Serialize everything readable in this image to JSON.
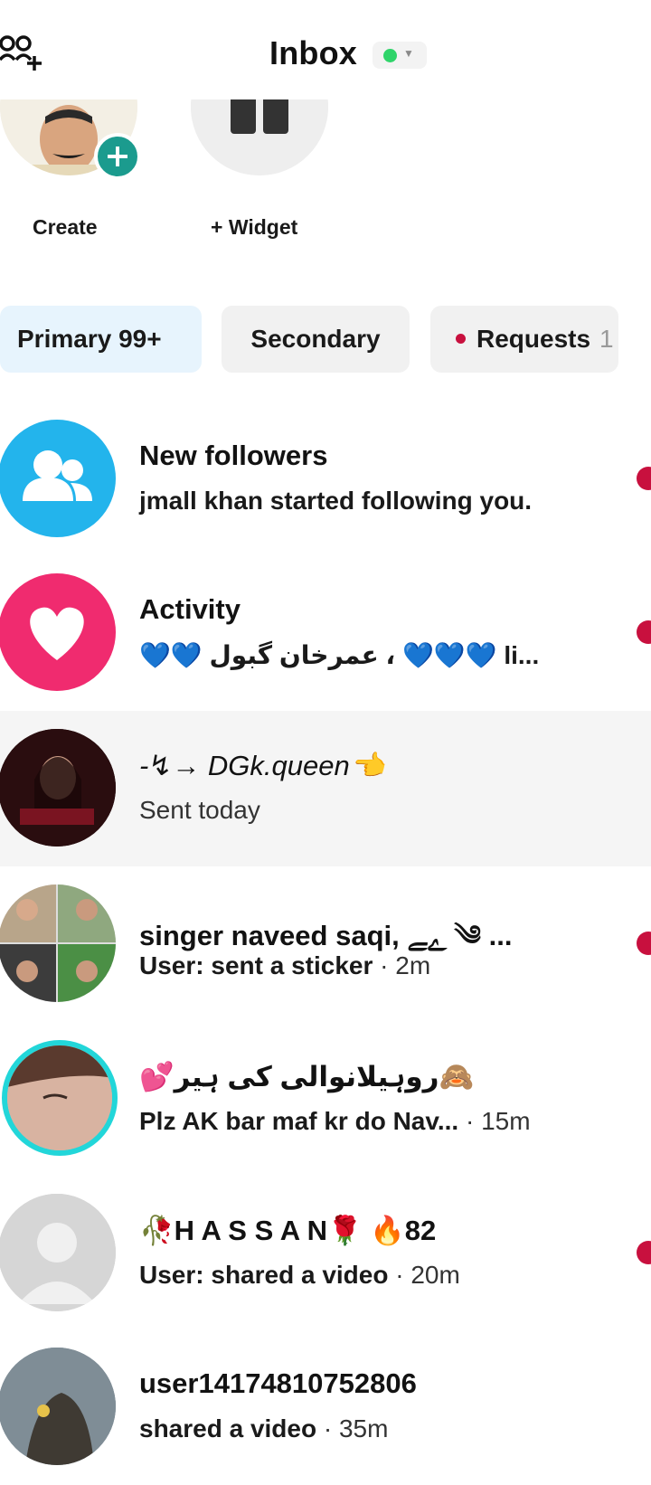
{
  "header": {
    "title": "Inbox",
    "status_color": "#2fd46a",
    "add_friends_icon": "add-friends-icon"
  },
  "stories": {
    "create_label": "Create",
    "widget_label": "+ Widget"
  },
  "tabs": {
    "primary": "Primary 99+",
    "secondary": "Secondary",
    "requests": "Requests",
    "requests_count": "1"
  },
  "threads": [
    {
      "title": "New followers",
      "subtitle": "jmall khan started following you.",
      "time": "",
      "icon": "people-icon",
      "unread": true
    },
    {
      "title": "Activity",
      "subtitle": "💙💙 عمرخان گبول ، 💙💙💙 li...",
      "time": "",
      "icon": "heart-icon",
      "unread": true
    },
    {
      "title": "-↯→ DGk.queen👈",
      "subtitle": "Sent today",
      "time": "",
      "unread": false
    },
    {
      "title": "singer naveed saqi, ﮮﮯ ༄ ...",
      "subtitle": "User: sent a sticker",
      "time": " · 2m",
      "unread": true
    },
    {
      "title": "💕روہیلانوالی کی ہیر🙈",
      "subtitle": "Plz AK bar maf kr do Nav...",
      "time": "  · 15m",
      "unread": false
    },
    {
      "title": "🥀H A S S A N🌹 🔥82",
      "subtitle": "User: shared a video",
      "time": " · 20m",
      "unread": true
    },
    {
      "title": "user14174810752806",
      "subtitle": "shared a video",
      "time": " · 35m",
      "unread": false
    }
  ]
}
